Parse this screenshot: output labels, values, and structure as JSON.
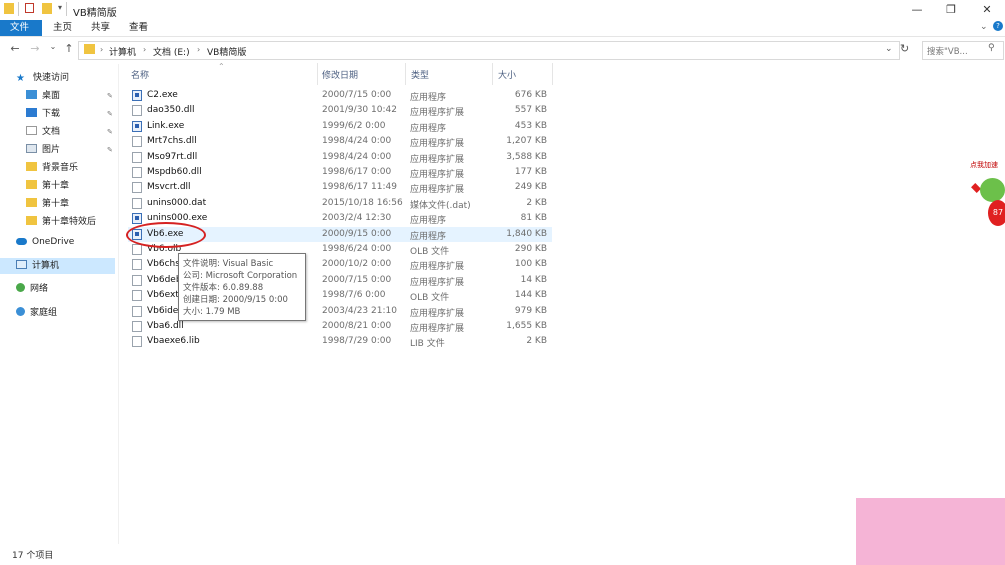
{
  "window": {
    "title": "VB精简版",
    "controls": [
      "minimize-icon",
      "maximize-icon",
      "close-icon"
    ]
  },
  "ribbon": {
    "tabs": [
      "文件",
      "主页",
      "共享",
      "查看"
    ]
  },
  "address": {
    "breadcrumbs": [
      "计算机",
      "文档 (E:)",
      "VB精简版"
    ],
    "search_placeholder": "搜索\"VB..."
  },
  "nav": {
    "quick_access": "快速访问",
    "items": [
      {
        "label": "桌面",
        "icon": "desktop-icon",
        "pinned": true
      },
      {
        "label": "下载",
        "icon": "download-icon",
        "pinned": true
      },
      {
        "label": "文档",
        "icon": "document-icon",
        "pinned": true
      },
      {
        "label": "图片",
        "icon": "picture-icon",
        "pinned": true
      },
      {
        "label": "背景音乐",
        "icon": "folder-icon",
        "pinned": false
      },
      {
        "label": "第十章",
        "icon": "folder-icon",
        "pinned": false
      },
      {
        "label": "第十章",
        "icon": "folder-icon",
        "pinned": false
      },
      {
        "label": "第十章特效后",
        "icon": "folder-icon",
        "pinned": false
      }
    ],
    "onedrive": "OneDrive",
    "computer": "计算机",
    "network": "网络",
    "homegroup": "家庭组"
  },
  "columns": [
    "名称",
    "修改日期",
    "类型",
    "大小"
  ],
  "files": [
    {
      "name": "C2.exe",
      "date": "2000/7/15 0:00",
      "type": "应用程序",
      "size": "676 KB",
      "icon": "exe"
    },
    {
      "name": "dao350.dll",
      "date": "2001/9/30 10:42",
      "type": "应用程序扩展",
      "size": "557 KB",
      "icon": "dll"
    },
    {
      "name": "Link.exe",
      "date": "1999/6/2 0:00",
      "type": "应用程序",
      "size": "453 KB",
      "icon": "exe"
    },
    {
      "name": "Mrt7chs.dll",
      "date": "1998/4/24 0:00",
      "type": "应用程序扩展",
      "size": "1,207 KB",
      "icon": "dll"
    },
    {
      "name": "Mso97rt.dll",
      "date": "1998/4/24 0:00",
      "type": "应用程序扩展",
      "size": "3,588 KB",
      "icon": "dll"
    },
    {
      "name": "Mspdb60.dll",
      "date": "1998/6/17 0:00",
      "type": "应用程序扩展",
      "size": "177 KB",
      "icon": "dll"
    },
    {
      "name": "Msvcrt.dll",
      "date": "1998/6/17 11:49",
      "type": "应用程序扩展",
      "size": "249 KB",
      "icon": "dll"
    },
    {
      "name": "unins000.dat",
      "date": "2015/10/18 16:56",
      "type": "媒体文件(.dat)",
      "size": "2 KB",
      "icon": "dat"
    },
    {
      "name": "unins000.exe",
      "date": "2003/2/4 12:30",
      "type": "应用程序",
      "size": "81 KB",
      "icon": "exe"
    },
    {
      "name": "Vb6.exe",
      "date": "2000/9/15 0:00",
      "type": "应用程序",
      "size": "1,840 KB",
      "icon": "exe"
    },
    {
      "name": "Vb6.olb",
      "date": "1998/6/24 0:00",
      "type": "OLB 文件",
      "size": "290 KB",
      "icon": "file"
    },
    {
      "name": "Vb6chs.dll",
      "date": "2000/10/2 0:00",
      "type": "应用程序扩展",
      "size": "100 KB",
      "icon": "dll"
    },
    {
      "name": "Vb6debug.dll",
      "date": "2000/7/15 0:00",
      "type": "应用程序扩展",
      "size": "14 KB",
      "icon": "dll"
    },
    {
      "name": "Vb6ext.olb",
      "date": "1998/7/6 0:00",
      "type": "OLB 文件",
      "size": "144 KB",
      "icon": "file"
    },
    {
      "name": "Vb6ide.dll",
      "date": "2003/4/23 21:10",
      "type": "应用程序扩展",
      "size": "979 KB",
      "icon": "dll"
    },
    {
      "name": "Vba6.dll",
      "date": "2000/8/21 0:00",
      "type": "应用程序扩展",
      "size": "1,655 KB",
      "icon": "dll"
    },
    {
      "name": "Vbaexe6.lib",
      "date": "1998/7/29 0:00",
      "type": "LIB 文件",
      "size": "2 KB",
      "icon": "file"
    }
  ],
  "tooltip": [
    "文件说明: Visual Basic",
    "公司: Microsoft Corporation",
    "文件版本: 6.0.89.88",
    "创建日期: 2000/9/15 0:00",
    "大小: 1.79 MB"
  ],
  "status": "17 个项目",
  "widget": {
    "text": "点我加速",
    "badge": "87"
  },
  "colors": {
    "accent": "#1979ca",
    "selection": "#cce8ff",
    "annotation": "#d52222",
    "overlay": "#f5b4d6"
  }
}
